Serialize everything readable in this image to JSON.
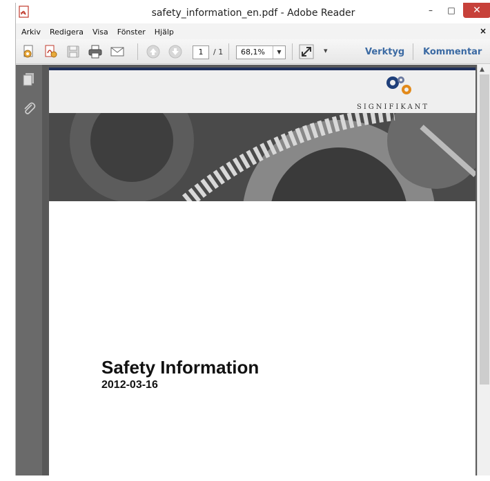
{
  "window": {
    "title": "safety_information_en.pdf - Adobe Reader",
    "minimize_glyph": "–",
    "maximize_glyph": "□",
    "close_glyph": "✕"
  },
  "menu": {
    "items": [
      {
        "label": "Arkiv"
      },
      {
        "label": "Redigera"
      },
      {
        "label": "Visa"
      },
      {
        "label": "Fönster"
      },
      {
        "label": "Hjälp"
      }
    ],
    "close_glyph": "×"
  },
  "toolbar": {
    "icons": [
      "create-pdf-icon",
      "convert-pdf-icon",
      "save-icon",
      "print-icon",
      "email-icon",
      "previous-page-icon",
      "next-page-icon",
      "fullscreen-icon",
      "toolbar-overflow-icon"
    ],
    "page_current": "1",
    "page_total": "/ 1",
    "zoom": "68,1%",
    "zoom_arrow": "▼",
    "overflow_glyph": "▾",
    "tools_label": "Verktyg",
    "comment_label": "Kommentar"
  },
  "nav_panel": {
    "icons": [
      "pages-icon",
      "attachment-icon"
    ]
  },
  "document": {
    "logo_text": "SIGNIFIKANT",
    "title": "Safety Information",
    "date": "2012-03-16"
  },
  "colors": {
    "link_blue": "#3b6aa3",
    "close_red": "#c7413a",
    "nav_gray": "#6a6a6a",
    "page_topline": "#1f2f5a"
  }
}
